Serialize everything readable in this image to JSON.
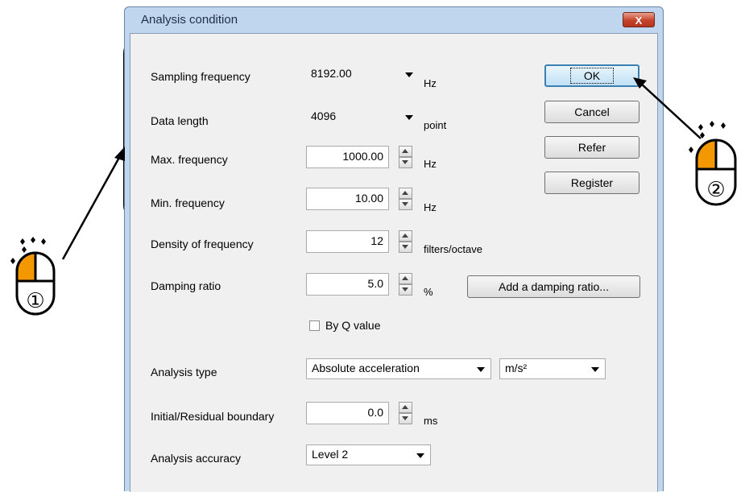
{
  "dialog": {
    "title": "Analysis condition",
    "close_label": "X",
    "fields": {
      "sampling_frequency": {
        "label": "Sampling frequency",
        "value": "8192.00",
        "unit": "Hz"
      },
      "data_length": {
        "label": "Data length",
        "value": "4096",
        "unit": "point"
      },
      "max_frequency": {
        "label": "Max. frequency",
        "value": "1000.00",
        "unit": "Hz"
      },
      "min_frequency": {
        "label": "Min. frequency",
        "value": "10.00",
        "unit": "Hz"
      },
      "density_of_frequency": {
        "label": "Density of frequency",
        "value": "12",
        "unit": "filters/octave"
      },
      "damping_ratio": {
        "label": "Damping ratio",
        "value": "5.0",
        "unit": "%"
      },
      "by_q_value": {
        "label": "By Q value",
        "checked": false
      },
      "analysis_type": {
        "label": "Analysis type",
        "value": "Absolute acceleration",
        "unit_value": "m/s²"
      },
      "initial_residual_boundary": {
        "label": "Initial/Residual boundary",
        "value": "0.0",
        "unit": "ms"
      },
      "analysis_accuracy": {
        "label": "Analysis accuracy",
        "value": "Level 2"
      }
    },
    "buttons": {
      "ok": "OK",
      "cancel": "Cancel",
      "refer": "Refer",
      "register": "Register",
      "add_damping_ratio": "Add a damping ratio..."
    }
  },
  "annotations": {
    "step1": "①",
    "step2": "②",
    "mouse_color": "#f39800"
  }
}
